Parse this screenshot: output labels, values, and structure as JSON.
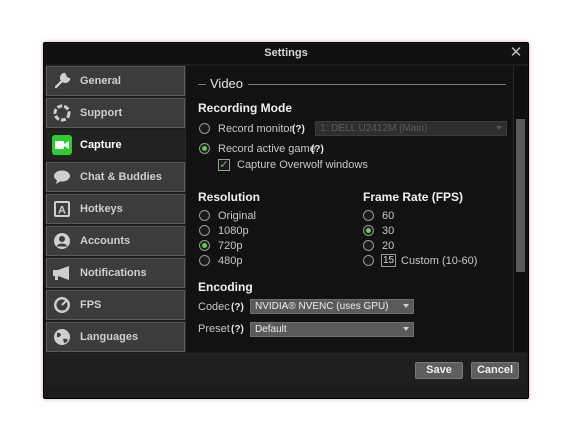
{
  "window": {
    "title": "Settings",
    "close_glyph": "✕"
  },
  "sidebar": {
    "items": [
      {
        "label": "General",
        "icon": "wrench-icon"
      },
      {
        "label": "Support",
        "icon": "lifebuoy-icon"
      },
      {
        "label": "Capture",
        "icon": "camera-icon",
        "active": true
      },
      {
        "label": "Chat & Buddies",
        "icon": "chat-bubble-icon"
      },
      {
        "label": "Hotkeys",
        "icon": "keyboard-key-icon"
      },
      {
        "label": "Accounts",
        "icon": "user-icon"
      },
      {
        "label": "Notifications",
        "icon": "megaphone-icon"
      },
      {
        "label": "FPS",
        "icon": "speedometer-icon"
      },
      {
        "label": "Languages",
        "icon": "globe-icon"
      }
    ]
  },
  "video": {
    "section_title": "Video",
    "recording_mode": {
      "heading": "Recording Mode",
      "record_monitor_label": "Record monitor",
      "record_monitor_help": "(?)",
      "monitor_select_value": "1: DELL U2412M (Main)",
      "record_active_game_label": "Record active game",
      "record_active_game_help": "(?)",
      "capture_overwolf_label": "Capture Overwolf windows",
      "selected": "record_active_game",
      "capture_overwolf_checked": true
    },
    "resolution": {
      "heading": "Resolution",
      "options": [
        "Original",
        "1080p",
        "720p",
        "480p"
      ],
      "selected": "720p"
    },
    "frame_rate": {
      "heading": "Frame Rate (FPS)",
      "options": [
        "60",
        "30",
        "20"
      ],
      "custom_value": "15",
      "custom_label": "Custom (10-60)",
      "selected": "30"
    },
    "encoding": {
      "heading": "Encoding",
      "codec_label": "Codec",
      "codec_help": "(?)",
      "codec_value": "NVIDIA® NVENC (uses GPU)",
      "preset_label": "Preset",
      "preset_help": "(?)",
      "preset_value": "Default"
    }
  },
  "footer": {
    "save_label": "Save",
    "cancel_label": "Cancel"
  },
  "colors": {
    "accent_green": "#5ad14c",
    "capture_icon_green": "#2ecc2e"
  }
}
